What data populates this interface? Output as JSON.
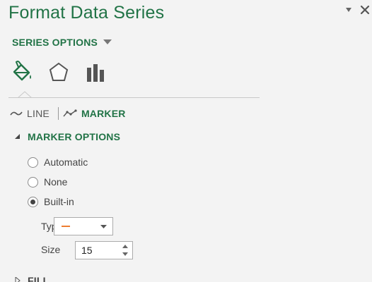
{
  "pane": {
    "title": "Format Data Series",
    "series_options_label": "SERIES OPTIONS"
  },
  "icons": {
    "pin": "pin-dropdown-icon",
    "close": "close-icon",
    "fill_line": "paint-bucket-icon",
    "effects": "pentagon-effects-icon",
    "series_options": "bar-chart-icon"
  },
  "subtabs": {
    "line_label": "LINE",
    "marker_label": "MARKER",
    "active": "MARKER"
  },
  "marker_options": {
    "header": "MARKER OPTIONS",
    "options": [
      {
        "label": "Automatic",
        "checked": false
      },
      {
        "label": "None",
        "checked": false
      },
      {
        "label": "Built-in",
        "checked": true
      }
    ],
    "type_label": "Type",
    "size_label": "Size",
    "size_value": "15"
  },
  "fill_section": {
    "header": "FILL"
  },
  "colors": {
    "accent": "#217346",
    "marker_type": "#ed7d31",
    "background": "#f3f3f3"
  }
}
